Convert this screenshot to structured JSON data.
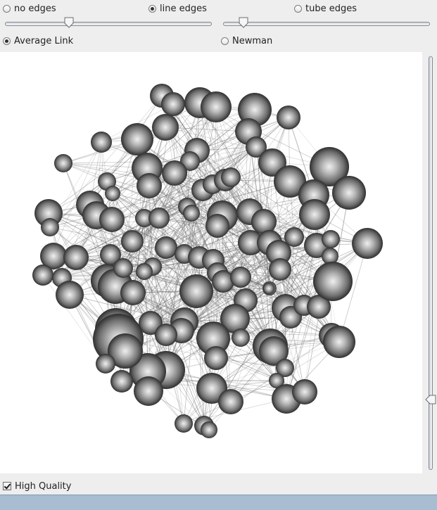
{
  "controls": {
    "edge_modes": [
      {
        "label": "no edges",
        "checked": false
      },
      {
        "label": "line edges",
        "checked": true
      },
      {
        "label": "tube edges",
        "checked": false
      }
    ],
    "slider_left_value": 0.31,
    "slider_right_value": 0.1,
    "clustering": [
      {
        "label": "Average Link",
        "checked": true
      },
      {
        "label": "Newman",
        "checked": false
      }
    ],
    "vertical_slider_value": 0.17,
    "high_quality": {
      "label": "High Quality",
      "checked": true
    }
  },
  "colors": {
    "sphere_light": "#ededed",
    "sphere_dark": "#2e2e2e",
    "edge": "#6b6b6b",
    "statusbar": "#a8bcd2"
  }
}
